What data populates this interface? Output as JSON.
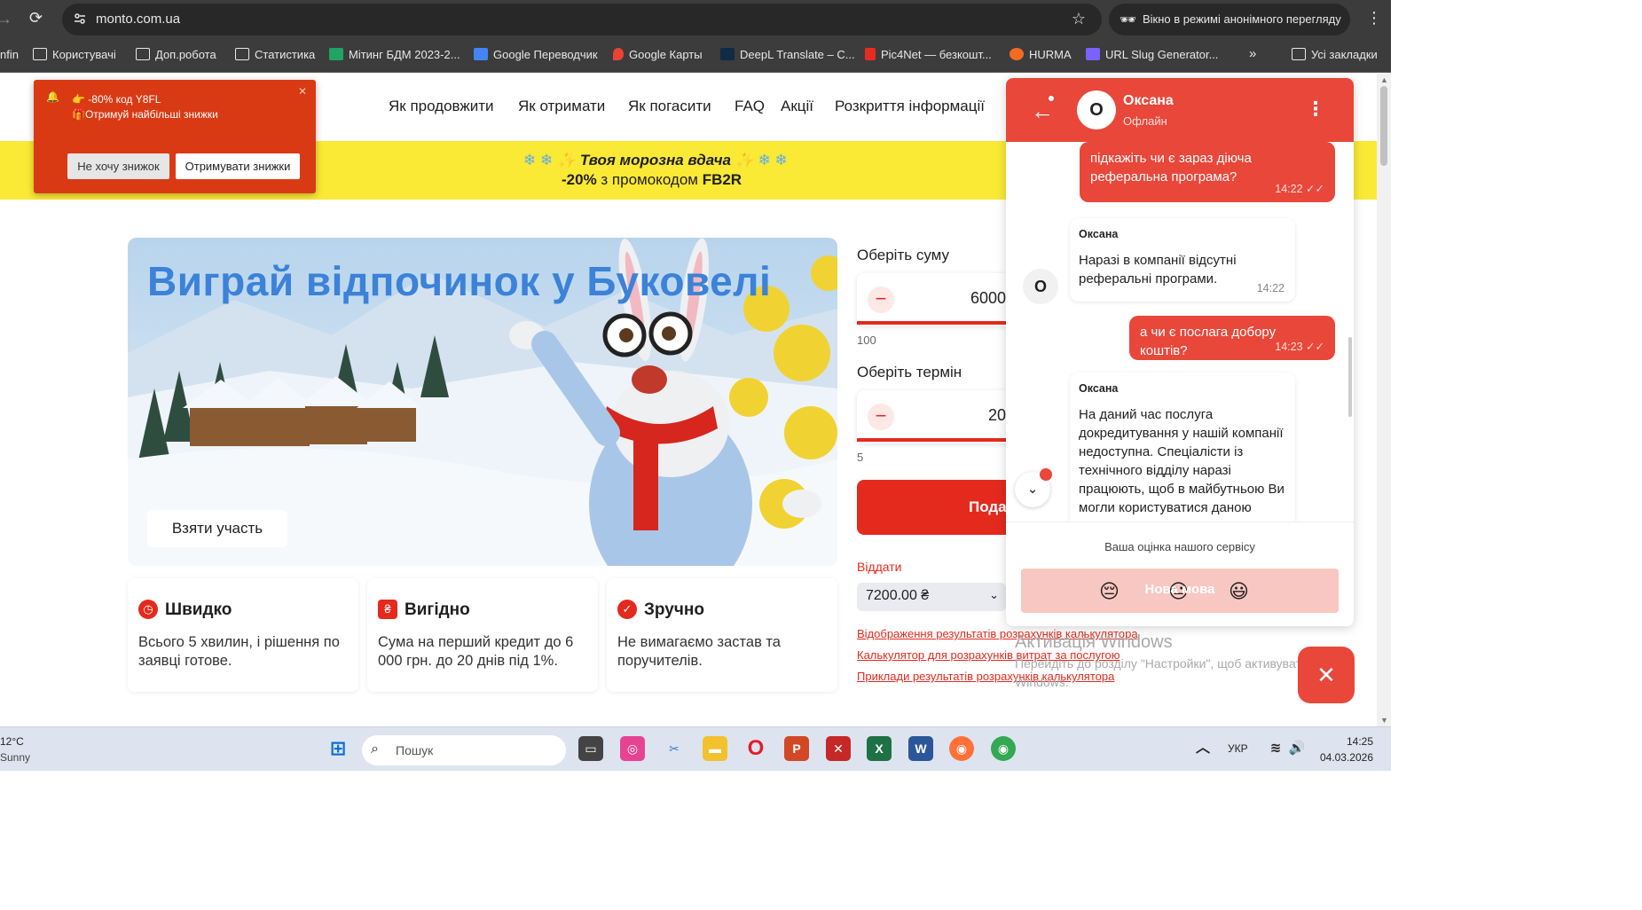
{
  "browser": {
    "url": "monto.com.ua",
    "incognito_label": "Вікно в режимі анонімного перегляду",
    "bookmarks": [
      {
        "label": "nfin",
        "icon": "partial"
      },
      {
        "label": "Користувачі",
        "icon": "folder"
      },
      {
        "label": "Доп.робота",
        "icon": "folder"
      },
      {
        "label": "Статистика",
        "icon": "folder"
      },
      {
        "label": "Мітинг БДМ 2023-2...",
        "icon": "sheets"
      },
      {
        "label": "Google Переводчик",
        "icon": "translate"
      },
      {
        "label": "Google Карты",
        "icon": "maps"
      },
      {
        "label": "DeepL Translate – С...",
        "icon": "deepl"
      },
      {
        "label": "Pic4Net — безкошт...",
        "icon": "pic4net"
      },
      {
        "label": "HURMA",
        "icon": "hurma"
      },
      {
        "label": "URL Slug Generator...",
        "icon": "slug"
      },
      {
        "label": "Усі закладки",
        "icon": "folder"
      }
    ]
  },
  "site": {
    "nav": [
      "Як продовжити",
      "Як отримати",
      "Як погасити",
      "FAQ",
      "Акції",
      "Розкриття інформації"
    ],
    "promo_line1": "Твоя морозна вдача",
    "promo_line2_prefix": "-20%",
    "promo_line2_mid": " з промокодом ",
    "promo_line2_code": "FB2R",
    "hero_title": "Виграй відпочинок у Буковелі",
    "hero_button": "Взяти участь",
    "features": [
      {
        "title": "Швидко",
        "desc": "Всього 5 хвилин, і рішення по заявці готове."
      },
      {
        "title": "Вигідно",
        "desc": "Сума на перший кредит до 6 000 грн. до 20 днів під 1%."
      },
      {
        "title": "Зручно",
        "desc": "Не вимагаємо застав та поручителів."
      }
    ],
    "calculator": {
      "amount_label": "Оберіть суму",
      "amount_value": "6000",
      "amount_min": "100",
      "term_label": "Оберіть термін",
      "term_value": "20",
      "term_min": "5",
      "submit_label": "Пода",
      "repay_label": "Віддати",
      "repay_value": "7200.00 ₴"
    },
    "links": [
      "Відображення результатів розрахунків калькулятора",
      "Калькулятор для розрахунків витрат за послугою",
      "Приклади результатів розрахунків калькулятора"
    ]
  },
  "push": {
    "line1": "-80% код Y8FL",
    "line2": "Отримуй найбільші знижки",
    "decline": "Не хочу знижок",
    "accept": "Отримувати знижки"
  },
  "chat": {
    "agent_initial": "О",
    "agent_name": "Оксана",
    "agent_status": "Офлайн",
    "messages": [
      {
        "dir": "out",
        "text": "підкажіть чи є зараз діюча реферальна програма?",
        "time": "14:22"
      },
      {
        "dir": "in",
        "who": "Оксана",
        "text": "Наразі в компанії відсутні реферальні програми.",
        "time": "14:22"
      },
      {
        "dir": "out",
        "text": "а чи є послага добору коштів?",
        "time": "14:23"
      },
      {
        "dir": "in",
        "who": "Оксана",
        "text": "На даний час послуга докредитування у нашій компанії недоступна. Спеціалісти із технічного відділу наразі працюють, щоб в майбутньою Ви могли користуватися даною",
        "time": ""
      }
    ],
    "rating_question": "Ваша оцінка нашого сервісу",
    "new_language": "Нова мова"
  },
  "watermark": {
    "title": "Активація Windows",
    "line1": "Перейдіть до розділу \"Настройки\", щоб активувати",
    "line2": "Windows."
  },
  "taskbar": {
    "temp": "12°C",
    "weather": "Sunny",
    "search_placeholder": "Пошук",
    "lang": "УКР",
    "time": "14:25",
    "date": "04.03.2026"
  },
  "colors": {
    "brand_red": "#e32a1d",
    "chat_red": "#e8473a",
    "promo_yellow": "#fae935",
    "hero_title_blue": "#3b82d8"
  }
}
